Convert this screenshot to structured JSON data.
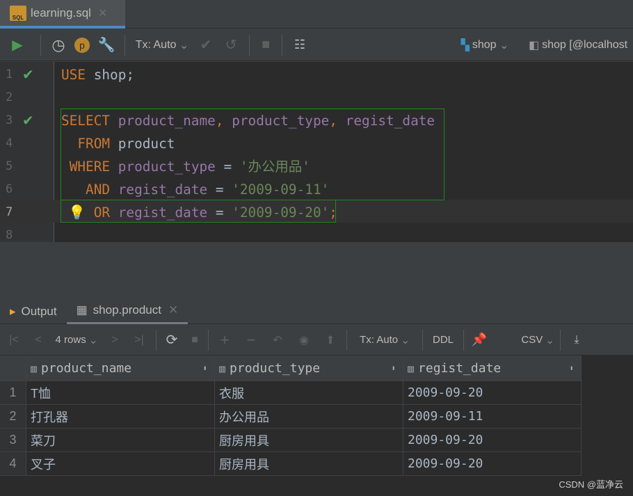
{
  "tab": {
    "title": "learning.sql",
    "icon": "sql-file-icon"
  },
  "toolbar": {
    "tx": "Tx: Auto",
    "schema": "shop",
    "datasource": "shop [@localhost"
  },
  "editor": {
    "lines": [
      {
        "n": "1",
        "check": true
      },
      {
        "n": "2"
      },
      {
        "n": "3",
        "check": true
      },
      {
        "n": "4"
      },
      {
        "n": "5"
      },
      {
        "n": "6"
      },
      {
        "n": "7"
      },
      {
        "n": "8"
      }
    ],
    "code": {
      "l1_kw": "USE",
      "l1_rest": " shop;",
      "l3_kw": "SELECT",
      "l3_c1": "product_name",
      "l3_c2": "product_type",
      "l3_c3": "regist_date",
      "l4_kw": "FROM",
      "l4_rest": " product",
      "l5_kw": "WHERE",
      "l5_id": "product_type",
      "l5_op": " = ",
      "l5_st": "'办公用品'",
      "l6_kw": "AND",
      "l6_id": "regist_date",
      "l6_op": " = ",
      "l6_st": "'2009-09-11'",
      "l7_kw": "OR",
      "l7_id": "regist_date",
      "l7_op": " = ",
      "l7_st": "'2009-09-20'",
      "l7_end": ";"
    }
  },
  "results": {
    "tabs": [
      "Output",
      "shop.product"
    ],
    "rows_label": "4 rows",
    "tx": "Tx: Auto",
    "ddl": "DDL",
    "csv": "CSV",
    "columns": [
      "product_name",
      "product_type",
      "regist_date"
    ],
    "rows": [
      [
        "1",
        "T恤",
        "衣服",
        "2009-09-20"
      ],
      [
        "2",
        "打孔器",
        "办公用品",
        "2009-09-11"
      ],
      [
        "3",
        "菜刀",
        "厨房用具",
        "2009-09-20"
      ],
      [
        "4",
        "叉子",
        "厨房用具",
        "2009-09-20"
      ]
    ]
  },
  "watermark": "CSDN @蓝净云",
  "colors": {
    "keyword": "#cc7832",
    "identifier": "#9876aa",
    "string": "#6a8759",
    "run": "#499c54",
    "accent": "#4a88c7"
  }
}
